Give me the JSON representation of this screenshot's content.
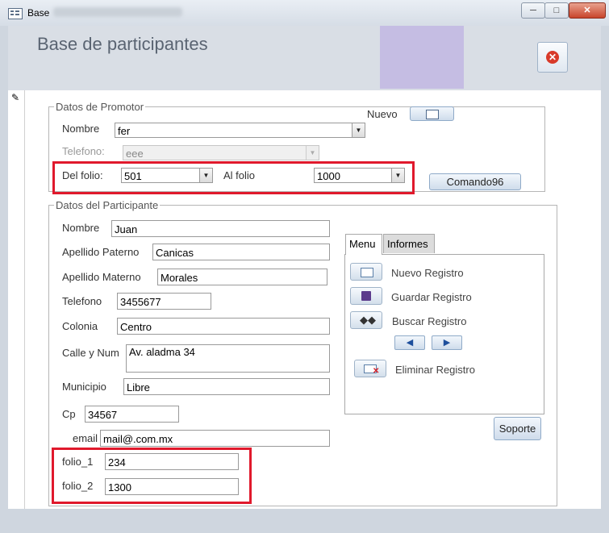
{
  "window": {
    "title": "Base"
  },
  "header": {
    "title": "Base de participantes"
  },
  "promotor": {
    "group_label": "Datos de Promotor",
    "nombre_label": "Nombre",
    "nombre_value": "fer",
    "telefono_label": "Telefono:",
    "telefono_value": "eee",
    "nuevo_label": "Nuevo",
    "del_folio_label": "Del folio:",
    "del_folio_value": "501",
    "al_folio_label": "Al folio",
    "al_folio_value": "1000",
    "comando_label": "Comando96"
  },
  "participante": {
    "group_label": "Datos del Participante",
    "fields": {
      "nombre": {
        "label": "Nombre",
        "value": "Juan"
      },
      "apellido_paterno": {
        "label": "Apellido Paterno",
        "value": "Canicas"
      },
      "apellido_materno": {
        "label": "Apellido Materno",
        "value": "Morales"
      },
      "telefono": {
        "label": "Telefono",
        "value": "3455677"
      },
      "colonia": {
        "label": "Colonia",
        "value": "Centro"
      },
      "calle": {
        "label": "Calle y Num",
        "value": "Av. aladma 34"
      },
      "municipio": {
        "label": "Municipio",
        "value": "Libre"
      },
      "cp": {
        "label": "Cp",
        "value": "34567"
      },
      "email": {
        "label": "email",
        "value": "mail@.com.mx"
      },
      "folio_1": {
        "label": "folio_1",
        "value": "234"
      },
      "folio_2": {
        "label": "folio_2",
        "value": "1300"
      }
    }
  },
  "tabs": {
    "menu": "Menu",
    "informes": "Informes"
  },
  "menu": {
    "nuevo_registro": "Nuevo Registro",
    "guardar_registro": "Guardar Registro",
    "buscar_registro": "Buscar Registro",
    "eliminar_registro": "Eliminar Registro"
  },
  "soporte_label": "Soporte",
  "colors": {
    "highlight": "#e0192c",
    "header_bg": "#d9dee5",
    "header_image": "#c5bde3"
  }
}
